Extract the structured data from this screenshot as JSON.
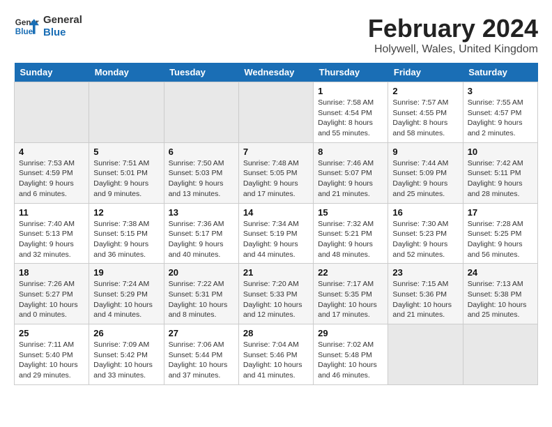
{
  "header": {
    "logo_general": "General",
    "logo_blue": "Blue",
    "month_year": "February 2024",
    "location": "Holywell, Wales, United Kingdom"
  },
  "weekdays": [
    "Sunday",
    "Monday",
    "Tuesday",
    "Wednesday",
    "Thursday",
    "Friday",
    "Saturday"
  ],
  "weeks": [
    [
      {
        "day": "",
        "info": ""
      },
      {
        "day": "",
        "info": ""
      },
      {
        "day": "",
        "info": ""
      },
      {
        "day": "",
        "info": ""
      },
      {
        "day": "1",
        "info": "Sunrise: 7:58 AM\nSunset: 4:54 PM\nDaylight: 8 hours\nand 55 minutes."
      },
      {
        "day": "2",
        "info": "Sunrise: 7:57 AM\nSunset: 4:55 PM\nDaylight: 8 hours\nand 58 minutes."
      },
      {
        "day": "3",
        "info": "Sunrise: 7:55 AM\nSunset: 4:57 PM\nDaylight: 9 hours\nand 2 minutes."
      }
    ],
    [
      {
        "day": "4",
        "info": "Sunrise: 7:53 AM\nSunset: 4:59 PM\nDaylight: 9 hours\nand 6 minutes."
      },
      {
        "day": "5",
        "info": "Sunrise: 7:51 AM\nSunset: 5:01 PM\nDaylight: 9 hours\nand 9 minutes."
      },
      {
        "day": "6",
        "info": "Sunrise: 7:50 AM\nSunset: 5:03 PM\nDaylight: 9 hours\nand 13 minutes."
      },
      {
        "day": "7",
        "info": "Sunrise: 7:48 AM\nSunset: 5:05 PM\nDaylight: 9 hours\nand 17 minutes."
      },
      {
        "day": "8",
        "info": "Sunrise: 7:46 AM\nSunset: 5:07 PM\nDaylight: 9 hours\nand 21 minutes."
      },
      {
        "day": "9",
        "info": "Sunrise: 7:44 AM\nSunset: 5:09 PM\nDaylight: 9 hours\nand 25 minutes."
      },
      {
        "day": "10",
        "info": "Sunrise: 7:42 AM\nSunset: 5:11 PM\nDaylight: 9 hours\nand 28 minutes."
      }
    ],
    [
      {
        "day": "11",
        "info": "Sunrise: 7:40 AM\nSunset: 5:13 PM\nDaylight: 9 hours\nand 32 minutes."
      },
      {
        "day": "12",
        "info": "Sunrise: 7:38 AM\nSunset: 5:15 PM\nDaylight: 9 hours\nand 36 minutes."
      },
      {
        "day": "13",
        "info": "Sunrise: 7:36 AM\nSunset: 5:17 PM\nDaylight: 9 hours\nand 40 minutes."
      },
      {
        "day": "14",
        "info": "Sunrise: 7:34 AM\nSunset: 5:19 PM\nDaylight: 9 hours\nand 44 minutes."
      },
      {
        "day": "15",
        "info": "Sunrise: 7:32 AM\nSunset: 5:21 PM\nDaylight: 9 hours\nand 48 minutes."
      },
      {
        "day": "16",
        "info": "Sunrise: 7:30 AM\nSunset: 5:23 PM\nDaylight: 9 hours\nand 52 minutes."
      },
      {
        "day": "17",
        "info": "Sunrise: 7:28 AM\nSunset: 5:25 PM\nDaylight: 9 hours\nand 56 minutes."
      }
    ],
    [
      {
        "day": "18",
        "info": "Sunrise: 7:26 AM\nSunset: 5:27 PM\nDaylight: 10 hours\nand 0 minutes."
      },
      {
        "day": "19",
        "info": "Sunrise: 7:24 AM\nSunset: 5:29 PM\nDaylight: 10 hours\nand 4 minutes."
      },
      {
        "day": "20",
        "info": "Sunrise: 7:22 AM\nSunset: 5:31 PM\nDaylight: 10 hours\nand 8 minutes."
      },
      {
        "day": "21",
        "info": "Sunrise: 7:20 AM\nSunset: 5:33 PM\nDaylight: 10 hours\nand 12 minutes."
      },
      {
        "day": "22",
        "info": "Sunrise: 7:17 AM\nSunset: 5:35 PM\nDaylight: 10 hours\nand 17 minutes."
      },
      {
        "day": "23",
        "info": "Sunrise: 7:15 AM\nSunset: 5:36 PM\nDaylight: 10 hours\nand 21 minutes."
      },
      {
        "day": "24",
        "info": "Sunrise: 7:13 AM\nSunset: 5:38 PM\nDaylight: 10 hours\nand 25 minutes."
      }
    ],
    [
      {
        "day": "25",
        "info": "Sunrise: 7:11 AM\nSunset: 5:40 PM\nDaylight: 10 hours\nand 29 minutes."
      },
      {
        "day": "26",
        "info": "Sunrise: 7:09 AM\nSunset: 5:42 PM\nDaylight: 10 hours\nand 33 minutes."
      },
      {
        "day": "27",
        "info": "Sunrise: 7:06 AM\nSunset: 5:44 PM\nDaylight: 10 hours\nand 37 minutes."
      },
      {
        "day": "28",
        "info": "Sunrise: 7:04 AM\nSunset: 5:46 PM\nDaylight: 10 hours\nand 41 minutes."
      },
      {
        "day": "29",
        "info": "Sunrise: 7:02 AM\nSunset: 5:48 PM\nDaylight: 10 hours\nand 46 minutes."
      },
      {
        "day": "",
        "info": ""
      },
      {
        "day": "",
        "info": ""
      }
    ]
  ]
}
